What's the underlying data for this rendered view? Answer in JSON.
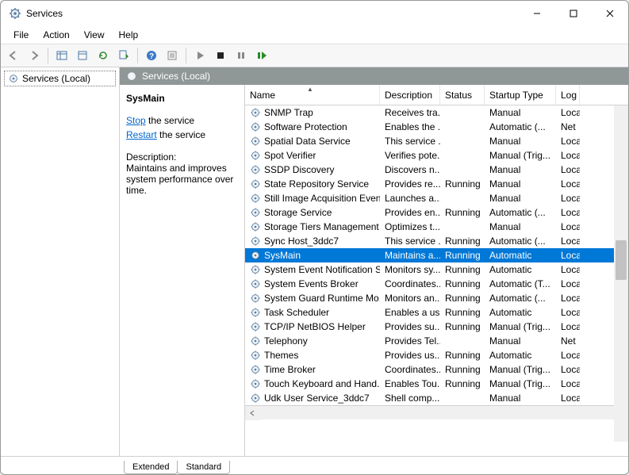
{
  "window": {
    "title": "Services"
  },
  "menu": {
    "file": "File",
    "action": "Action",
    "view": "View",
    "help": "Help"
  },
  "tree": {
    "root": "Services (Local)"
  },
  "pane_header": "Services (Local)",
  "detail": {
    "selected_name": "SysMain",
    "stop_label": "Stop",
    "stop_suffix": " the service",
    "restart_label": "Restart",
    "restart_suffix": " the service",
    "desc_heading": "Description:",
    "desc_text": "Maintains and improves system performance over time."
  },
  "columns": {
    "name": "Name",
    "desc": "Description",
    "status": "Status",
    "startup": "Startup Type",
    "log": "Log"
  },
  "tabs": {
    "extended": "Extended",
    "standard": "Standard"
  },
  "services": [
    {
      "name": "SNMP Trap",
      "desc": "Receives tra...",
      "status": "",
      "startup": "Manual",
      "log": "Loca"
    },
    {
      "name": "Software Protection",
      "desc": "Enables the ...",
      "status": "",
      "startup": "Automatic (...",
      "log": "Net"
    },
    {
      "name": "Spatial Data Service",
      "desc": "This service ...",
      "status": "",
      "startup": "Manual",
      "log": "Loca"
    },
    {
      "name": "Spot Verifier",
      "desc": "Verifies pote...",
      "status": "",
      "startup": "Manual (Trig...",
      "log": "Loca"
    },
    {
      "name": "SSDP Discovery",
      "desc": "Discovers n...",
      "status": "",
      "startup": "Manual",
      "log": "Loca"
    },
    {
      "name": "State Repository Service",
      "desc": "Provides re...",
      "status": "Running",
      "startup": "Manual",
      "log": "Loca"
    },
    {
      "name": "Still Image Acquisition Events",
      "desc": "Launches a...",
      "status": "",
      "startup": "Manual",
      "log": "Loca"
    },
    {
      "name": "Storage Service",
      "desc": "Provides en...",
      "status": "Running",
      "startup": "Automatic (...",
      "log": "Loca"
    },
    {
      "name": "Storage Tiers Management",
      "desc": "Optimizes t...",
      "status": "",
      "startup": "Manual",
      "log": "Loca"
    },
    {
      "name": "Sync Host_3ddc7",
      "desc": "This service ...",
      "status": "Running",
      "startup": "Automatic (...",
      "log": "Loca"
    },
    {
      "name": "SysMain",
      "desc": "Maintains a...",
      "status": "Running",
      "startup": "Automatic",
      "log": "Loca",
      "selected": true
    },
    {
      "name": "System Event Notification S...",
      "desc": "Monitors sy...",
      "status": "Running",
      "startup": "Automatic",
      "log": "Loca"
    },
    {
      "name": "System Events Broker",
      "desc": "Coordinates...",
      "status": "Running",
      "startup": "Automatic (T...",
      "log": "Loca"
    },
    {
      "name": "System Guard Runtime Mo...",
      "desc": "Monitors an...",
      "status": "Running",
      "startup": "Automatic (...",
      "log": "Loca"
    },
    {
      "name": "Task Scheduler",
      "desc": "Enables a us...",
      "status": "Running",
      "startup": "Automatic",
      "log": "Loca"
    },
    {
      "name": "TCP/IP NetBIOS Helper",
      "desc": "Provides su...",
      "status": "Running",
      "startup": "Manual (Trig...",
      "log": "Loca"
    },
    {
      "name": "Telephony",
      "desc": "Provides Tel...",
      "status": "",
      "startup": "Manual",
      "log": "Net"
    },
    {
      "name": "Themes",
      "desc": "Provides us...",
      "status": "Running",
      "startup": "Automatic",
      "log": "Loca"
    },
    {
      "name": "Time Broker",
      "desc": "Coordinates...",
      "status": "Running",
      "startup": "Manual (Trig...",
      "log": "Loca"
    },
    {
      "name": "Touch Keyboard and Hand...",
      "desc": "Enables Tou...",
      "status": "Running",
      "startup": "Manual (Trig...",
      "log": "Loca"
    },
    {
      "name": "Udk User Service_3ddc7",
      "desc": "Shell comp...",
      "status": "",
      "startup": "Manual",
      "log": "Loca"
    }
  ]
}
